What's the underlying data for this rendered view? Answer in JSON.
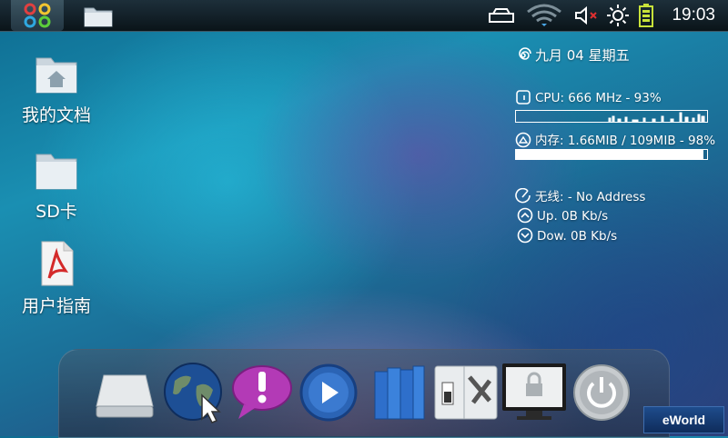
{
  "statusbar": {
    "menu_icon": "app-menu-icon",
    "folder_icon": "folder-icon",
    "status_icons": [
      "usb-drive-icon",
      "wifi-icon",
      "volume-muted-icon",
      "brightness-icon",
      "battery-icon"
    ],
    "time": "19:03"
  },
  "desktop": {
    "icons": [
      {
        "label": "我的文档",
        "icon": "home-folder-icon"
      },
      {
        "label": "SD卡",
        "icon": "folder-icon"
      },
      {
        "label": "用户指南",
        "icon": "pdf-file-icon"
      }
    ]
  },
  "monitor": {
    "date": "九月 04 星期五",
    "cpu": "CPU:  666 MHz - 93%",
    "memory": "内存: 1.66MIB / 109MIB - 98%",
    "memory_percent": 98,
    "wireless": "无线:  - No Address",
    "up": "Up.  0B    Kb/s",
    "down": "Dow. 0B    Kb/s"
  },
  "dock": {
    "items": [
      "drive-icon",
      "browser-globe-icon",
      "alert-chat-icon",
      "media-play-icon",
      "books-icon",
      "settings-tools-icon",
      "lock-screen-icon",
      "power-icon"
    ]
  },
  "brand": "eWorld",
  "colors": {
    "accent": "#1a8fb2",
    "dock": "#465a6e"
  }
}
